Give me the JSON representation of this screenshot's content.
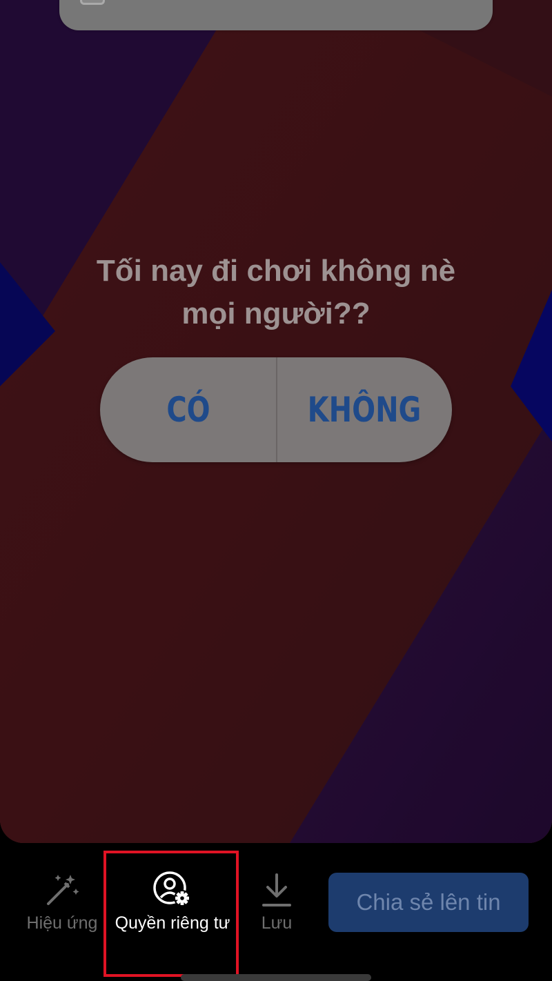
{
  "story": {
    "question": "Tối nay đi chơi không nè mọi người??",
    "poll_options": [
      "CÓ",
      "KHÔNG"
    ]
  },
  "toolbar": {
    "effects_label": "Hiệu ứng",
    "privacy_label": "Quyền riêng tư",
    "save_label": "Lưu",
    "share_label": "Chia sẻ lên tin"
  },
  "palette_colors": [
    "#8a3a40",
    "#5b5b5f",
    "#9a6a7a",
    "#3e6fa8",
    "#a98a8f",
    "#a69a4a"
  ],
  "icons": [
    "sticker-icon",
    "magic-wand-icon",
    "user-gear-icon",
    "download-icon"
  ],
  "colors": {
    "highlight": "#e01324",
    "share_button": "#1d3c6e",
    "poll_text": "#1f4a8a"
  }
}
